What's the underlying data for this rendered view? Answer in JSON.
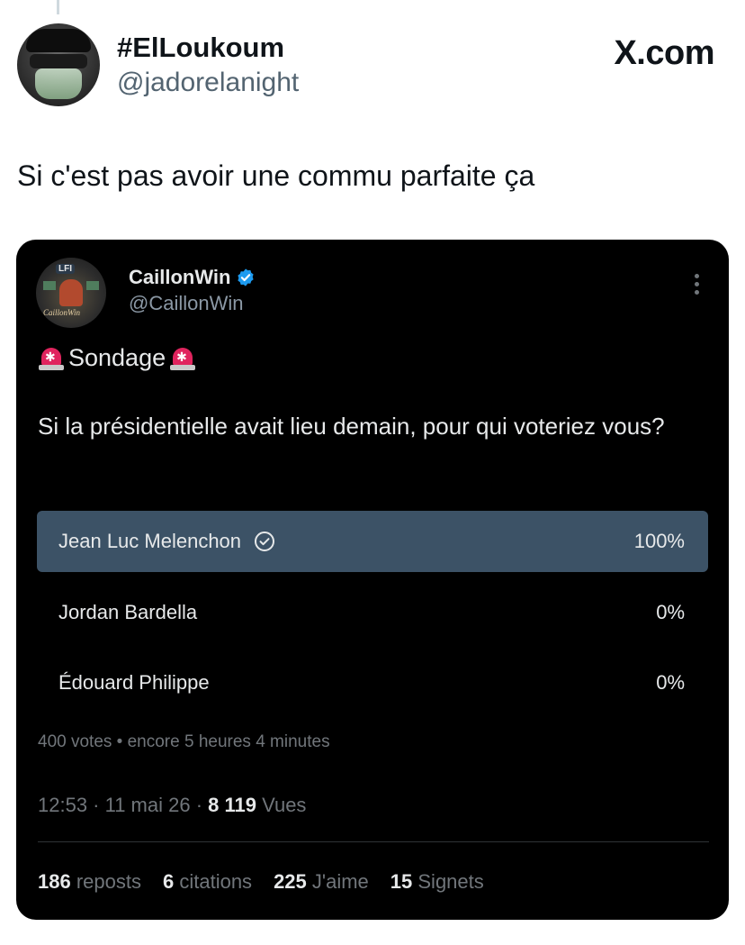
{
  "outer_tweet": {
    "display_name": "#ElLoukoum",
    "handle": "@jadorelanight",
    "brand": "X.com",
    "text": "Si c'est pas avoir une commu parfaite ça"
  },
  "quoted_tweet": {
    "display_name": "CaillonWin",
    "handle": "@CaillonWin",
    "verified_color": "#1d9bf0",
    "avatar_texts": [
      "LFI",
      "CaillonWin"
    ],
    "heading": "Sondage",
    "question": "Si la présidentielle avait lieu demain, pour qui voteriez vous?",
    "poll": {
      "options": [
        {
          "label": "Jean Luc Melenchon",
          "percent": "100%",
          "share": 1.0,
          "winner": true
        },
        {
          "label": "Jordan Bardella",
          "percent": "0%",
          "share": 0.0,
          "winner": false
        },
        {
          "label": "Édouard Philippe",
          "percent": "0%",
          "share": 0.0,
          "winner": false
        }
      ],
      "meta": "400 votes • encore 5 heures 4 minutes"
    },
    "timestamp": {
      "time_date": "12:53 · 11 mai 26 · ",
      "views_count": "8 119",
      "views_label": " Vues"
    },
    "stats": [
      {
        "count": "186",
        "label": " reposts"
      },
      {
        "count": "6",
        "label": " citations"
      },
      {
        "count": "225",
        "label": " J'aime"
      },
      {
        "count": "15",
        "label": " Signets"
      }
    ]
  },
  "colors": {
    "card_bg": "#000000",
    "poll_winner_fill": "#3c5266",
    "muted_text": "#71767b",
    "verified_badge": "#1d9bf0",
    "siren": "#e0245e"
  },
  "icons": [
    "verified-badge-icon",
    "more-options-icon",
    "siren-icon",
    "check-circle-icon"
  ]
}
